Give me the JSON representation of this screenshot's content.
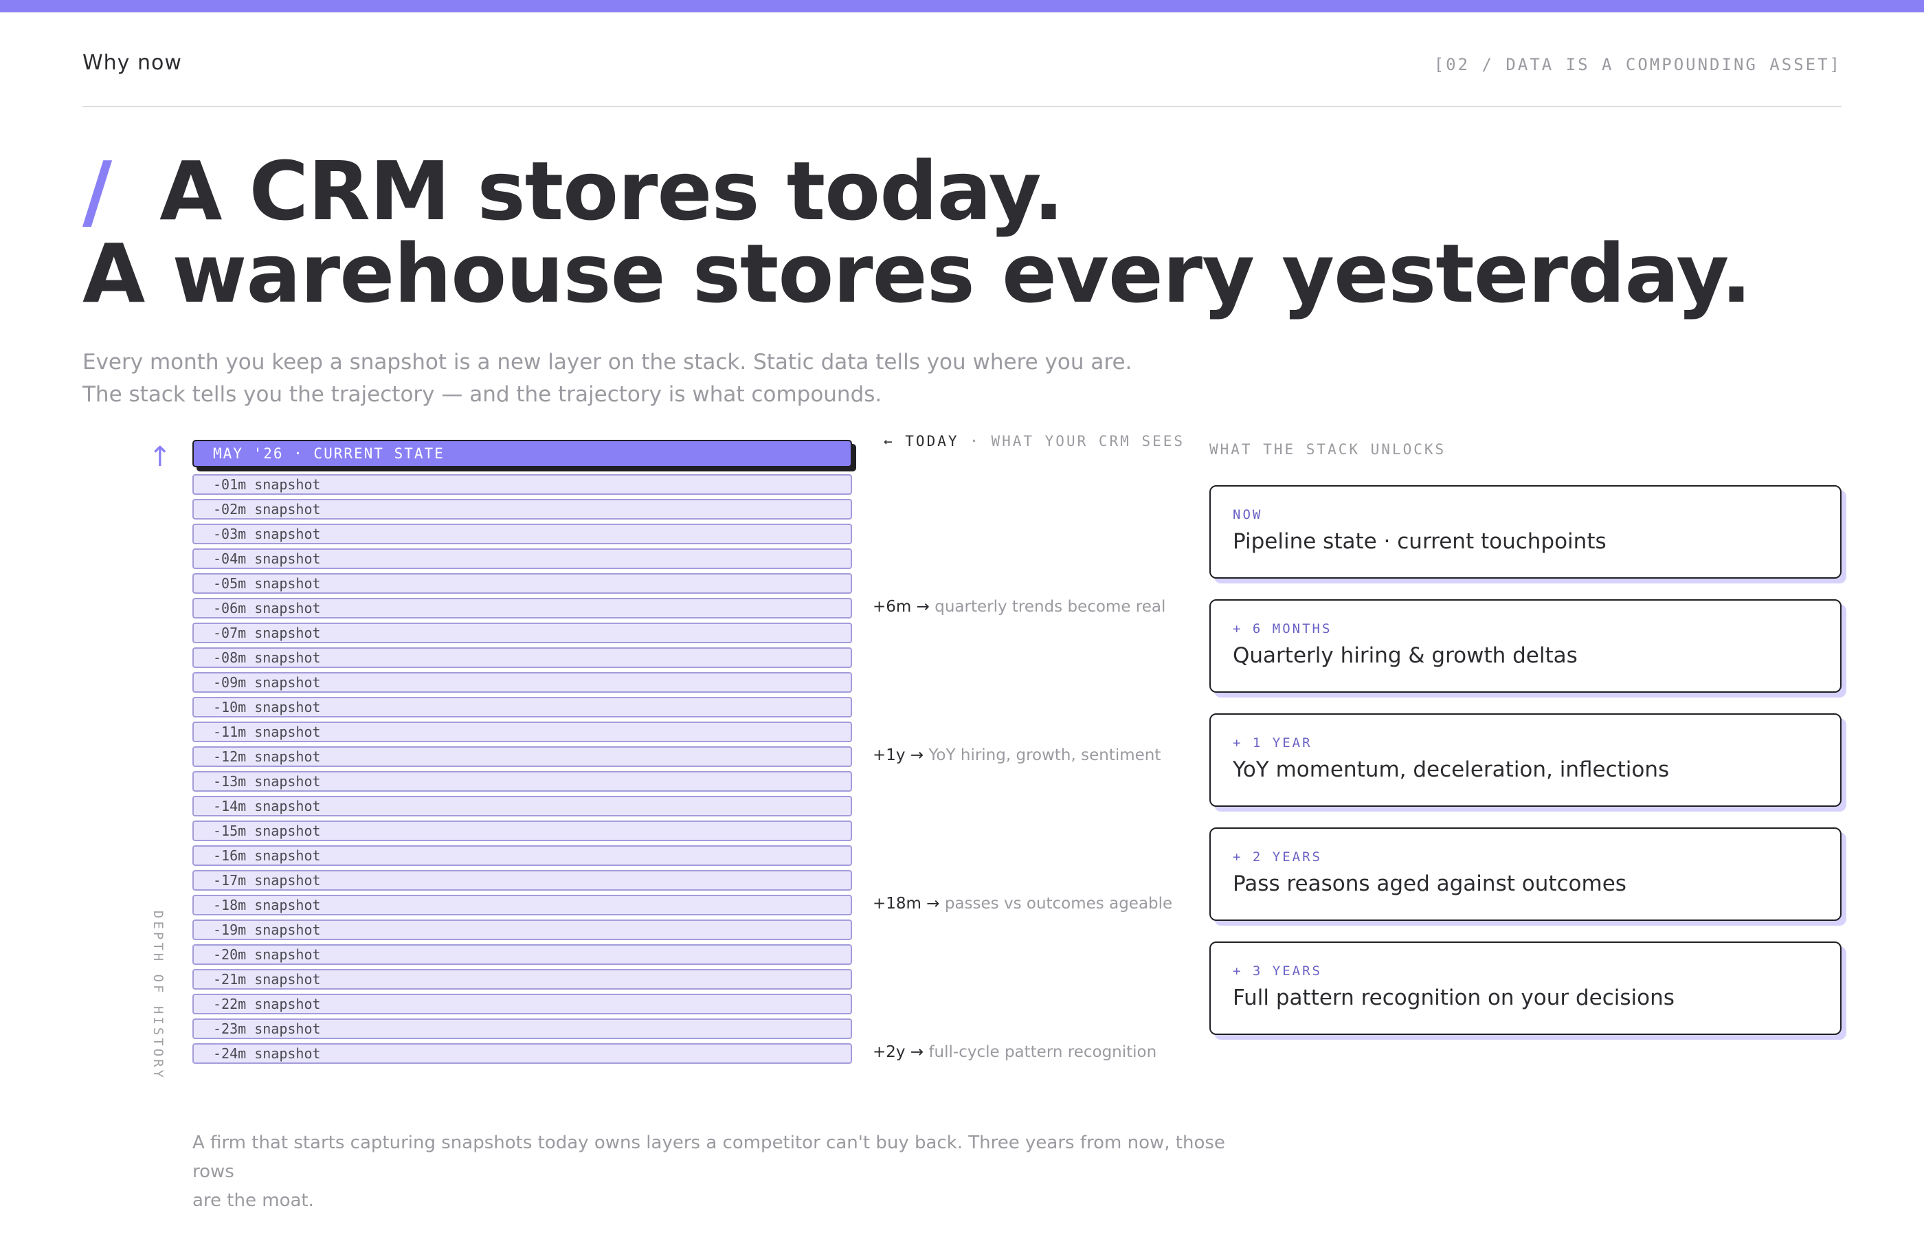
{
  "header": {
    "section": "Why now",
    "tag": "[02 / DATA IS A COMPOUNDING ASSET]"
  },
  "headline": {
    "slash": "/",
    "line1": "A CRM stores today.",
    "line2": "A warehouse stores every yesterday."
  },
  "subtext": {
    "line1": "Every month you keep a snapshot is a new layer on the stack. Static data tells you where you are.",
    "line2": "The stack tells you the trajectory — and the trajectory is what compounds."
  },
  "stack": {
    "up_arrow": "↑",
    "depth_label": "DEPTH OF HISTORY",
    "current_label": "MAY '26 · CURRENT STATE",
    "snapshots": [
      "-01m snapshot",
      "-02m snapshot",
      "-03m snapshot",
      "-04m snapshot",
      "-05m snapshot",
      "-06m snapshot",
      "-07m snapshot",
      "-08m snapshot",
      "-09m snapshot",
      "-10m snapshot",
      "-11m snapshot",
      "-12m snapshot",
      "-13m snapshot",
      "-14m snapshot",
      "-15m snapshot",
      "-16m snapshot",
      "-17m snapshot",
      "-18m snapshot",
      "-19m snapshot",
      "-20m snapshot",
      "-21m snapshot",
      "-22m snapshot",
      "-23m snapshot",
      "-24m snapshot"
    ]
  },
  "today": {
    "key": "← TODAY",
    "desc": " · WHAT YOUR CRM SEES"
  },
  "milestones": [
    {
      "key": "+6m",
      "arrow": " → ",
      "desc": "quarterly trends become real"
    },
    {
      "key": "+1y",
      "arrow": " → ",
      "desc": "YoY hiring, growth, sentiment"
    },
    {
      "key": "+18m",
      "arrow": " → ",
      "desc": "passes vs outcomes ageable"
    },
    {
      "key": "+2y",
      "arrow": " → ",
      "desc": "full-cycle pattern recognition"
    }
  ],
  "unlocks": {
    "label": "WHAT THE STACK UNLOCKS",
    "cards": [
      {
        "tag": "NOW",
        "title": "Pipeline state · current touchpoints"
      },
      {
        "tag": "+ 6 MONTHS",
        "title": "Quarterly hiring & growth deltas"
      },
      {
        "tag": "+ 1 YEAR",
        "title": "YoY momentum, deceleration, inflections"
      },
      {
        "tag": "+ 2 YEARS",
        "title": "Pass reasons aged against outcomes"
      },
      {
        "tag": "+ 3 YEARS",
        "title": "Full pattern recognition on your decisions"
      }
    ]
  },
  "footer": {
    "line1": "A firm that starts capturing snapshots today owns layers a competitor can't buy back. Three years from now, those rows",
    "line2": "are the moat."
  }
}
